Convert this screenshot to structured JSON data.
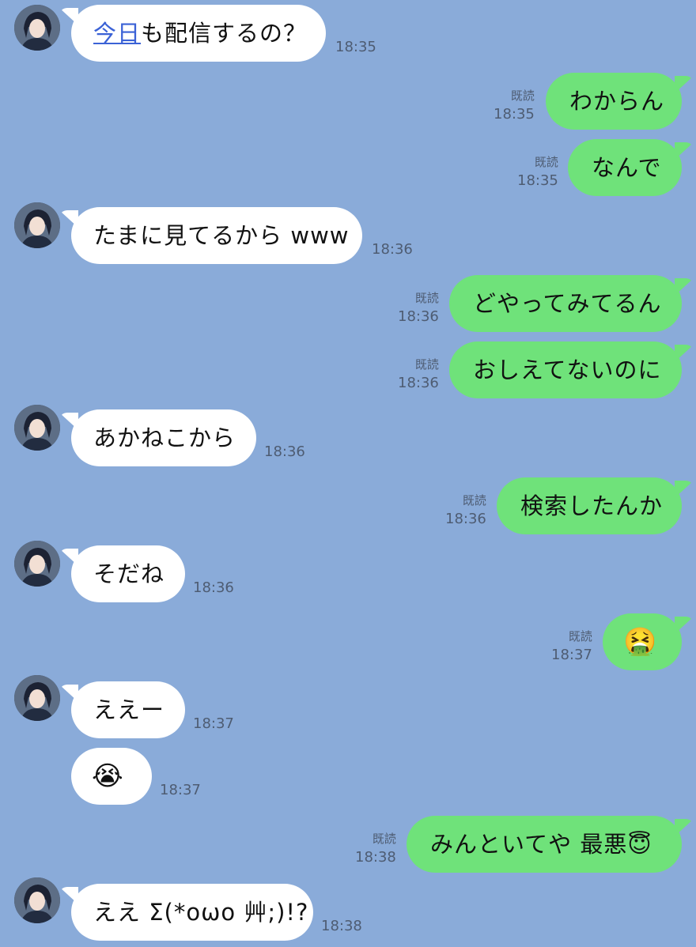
{
  "chat": {
    "messages": [
      {
        "side": "in",
        "avatar": true,
        "text_link": "今日",
        "text": "も配信するの？",
        "time": "18:35",
        "read": ""
      },
      {
        "side": "out",
        "text": "わからん",
        "time": "18:35",
        "read": "既読"
      },
      {
        "side": "out",
        "text": "なんで",
        "time": "18:35",
        "read": "既読"
      },
      {
        "side": "in",
        "avatar": true,
        "text": "たまに見てるから www",
        "time": "18:36",
        "read": ""
      },
      {
        "side": "out",
        "text": "どやってみてるん",
        "time": "18:36",
        "read": "既読"
      },
      {
        "side": "out",
        "text": "おしえてないのに",
        "time": "18:36",
        "read": "既読"
      },
      {
        "side": "in",
        "avatar": true,
        "text": "あかねこから",
        "time": "18:36",
        "read": ""
      },
      {
        "side": "out",
        "text": "検索したんか",
        "time": "18:36",
        "read": "既読"
      },
      {
        "side": "in",
        "avatar": true,
        "text": "そだね",
        "time": "18:36",
        "read": ""
      },
      {
        "side": "out",
        "text": "🤮",
        "emoji_only": true,
        "time": "18:37",
        "read": "既読"
      },
      {
        "side": "in",
        "avatar": true,
        "text": "ええー",
        "time": "18:37",
        "read": ""
      },
      {
        "side": "in",
        "avatar": false,
        "text": "😭",
        "emoji_only": true,
        "time": "18:37",
        "read": ""
      },
      {
        "side": "out",
        "text": "みんといてや 最悪😇",
        "time": "18:38",
        "read": "既読"
      },
      {
        "side": "in",
        "avatar": true,
        "text": "ええ Σ(*oωo 艸;)!?",
        "time": "18:38",
        "read": ""
      }
    ]
  },
  "colors": {
    "background": "#8aabd9",
    "incoming_bubble": "#ffffff",
    "outgoing_bubble": "#6fe27a",
    "meta_text": "#4e5c72",
    "link": "#3b62d6"
  }
}
